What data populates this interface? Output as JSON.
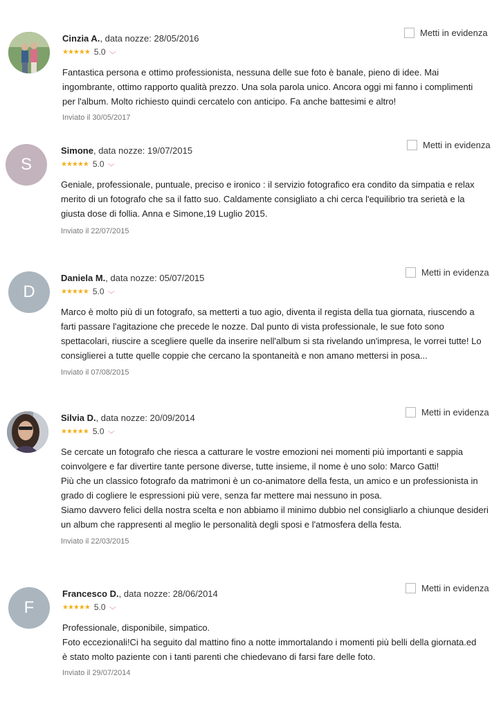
{
  "feature_label": "Metti in evidenza",
  "colors": {
    "star": "#f2b01e",
    "avatar_s": "#c3b3bd",
    "avatar_d": "#aab5be",
    "avatar_f": "#aab5be"
  },
  "reviews": [
    {
      "name": "Cinzia A.",
      "date": ", data nozze: 28/05/2016",
      "rating": "5.0",
      "stars": "★★★★★",
      "body": [
        "Fantastica persona e ottimo professionista, nessuna delle sue foto è banale, pieno di idee. Mai ingombrante, ottimo rapporto qualità prezzo. Una sola parola unico. Ancora oggi mi fanno i complimenti per l'album. Molto richiesto quindi cercatelo con anticipo. Fa anche battesimi e altro!"
      ],
      "sent": "Inviato il 30/05/2017"
    },
    {
      "name": "Simone",
      "date": ", data nozze: 19/07/2015",
      "rating": "5.0",
      "stars": "★★★★★",
      "initial": "S",
      "body": [
        "Geniale, professionale, puntuale, preciso e ironico : il servizio fotografico era condito da simpatia e relax merito di un fotografo che sa il fatto suo. Caldamente consigliato a chi cerca l'equilibrio tra serietà e la giusta dose di follia. Anna e Simone,19 Luglio 2015."
      ],
      "sent": "Inviato il 22/07/2015"
    },
    {
      "name": "Daniela M.",
      "date": ", data nozze: 05/07/2015",
      "rating": "5.0",
      "stars": "★★★★★",
      "initial": "D",
      "body": [
        "Marco è molto più di un fotografo, sa metterti a tuo agio, diventa il regista della tua giornata, riuscendo a farti passare l'agitazione che precede le nozze. Dal punto di vista professionale, le sue foto sono spettacolari, riuscire a scegliere quelle da inserire nell'album si sta rivelando un'impresa, le vorrei tutte! Lo consiglierei a tutte quelle coppie che cercano la spontaneità e non amano mettersi in posa..."
      ],
      "sent": "Inviato il 07/08/2015"
    },
    {
      "name": "Silvia D.",
      "date": ", data nozze: 20/09/2014",
      "rating": "5.0",
      "stars": "★★★★★",
      "body": [
        "Se cercate un fotografo che riesca a catturare le vostre emozioni nei momenti più importanti e sappia coinvolgere e far divertire tante persone diverse, tutte insieme, il nome è uno solo: Marco Gatti!",
        "Più che un classico fotografo da matrimoni è un co-animatore della festa, un amico e un professionista in grado di cogliere le espressioni più vere, senza far mettere mai nessuno in posa.",
        "Siamo davvero felici della nostra scelta e non abbiamo il minimo dubbio nel consigliarlo a chiunque desideri un album che rappresenti al meglio le personalità degli sposi e l'atmosfera della festa."
      ],
      "sent": "Inviato il 22/03/2015"
    },
    {
      "name": "Francesco D.",
      "date": ", data nozze: 28/06/2014",
      "rating": "5.0",
      "stars": "★★★★★",
      "initial": "F",
      "body": [
        "Professionale, disponibile, simpatico.",
        "Foto eccezionali!Ci ha seguito dal mattino fino a notte immortalando i momenti più belli della giornata.ed è stato molto paziente con i tanti parenti che chiedevano di farsi fare delle foto."
      ],
      "sent": "Inviato il 29/07/2014"
    }
  ]
}
